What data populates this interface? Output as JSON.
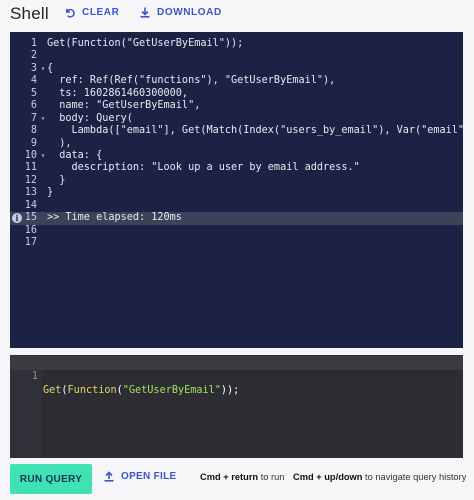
{
  "header": {
    "title": "Shell",
    "clear_label": "CLEAR",
    "download_label": "DOWNLOAD"
  },
  "output": {
    "highlight_line": 15,
    "lines": [
      {
        "num": "1",
        "fold": "",
        "text": "Get(Function(\"GetUserByEmail\"));"
      },
      {
        "num": "2",
        "fold": "",
        "text": ""
      },
      {
        "num": "3",
        "fold": "▾",
        "text": "{"
      },
      {
        "num": "4",
        "fold": "",
        "text": "  ref: Ref(Ref(\"functions\"), \"GetUserByEmail\"),"
      },
      {
        "num": "5",
        "fold": "",
        "text": "  ts: 1602861460300000,"
      },
      {
        "num": "6",
        "fold": "",
        "text": "  name: \"GetUserByEmail\","
      },
      {
        "num": "7",
        "fold": "▾",
        "text": "  body: Query("
      },
      {
        "num": "8",
        "fold": "",
        "text": "    Lambda([\"email\"], Get(Match(Index(\"users_by_email\"), Var(\"email\"))))"
      },
      {
        "num": "9",
        "fold": "",
        "text": "  ),"
      },
      {
        "num": "10",
        "fold": "▾",
        "text": "  data: {"
      },
      {
        "num": "11",
        "fold": "",
        "text": "    description: \"Look up a user by email address.\""
      },
      {
        "num": "12",
        "fold": "",
        "text": "  }"
      },
      {
        "num": "13",
        "fold": "",
        "text": "}"
      },
      {
        "num": "14",
        "fold": "",
        "text": ""
      },
      {
        "num": "15",
        "fold": "",
        "text": ">> Time elapsed: 120ms"
      },
      {
        "num": "16",
        "fold": "",
        "text": ""
      },
      {
        "num": "17",
        "fold": "",
        "text": ""
      }
    ]
  },
  "editor": {
    "line_number": "1",
    "tokens": {
      "fn1": "Get",
      "p1": "(",
      "fn2": "Function",
      "p2": "(",
      "str": "\"GetUserByEmail\"",
      "p3": "));"
    }
  },
  "footer": {
    "run_label": "RUN QUERY",
    "open_label": "OPEN FILE",
    "hint_run_key": "Cmd + return",
    "hint_run_text": " to run",
    "hint_nav_key": "Cmd + up/down",
    "hint_nav_text": " to navigate query history"
  },
  "colors": {
    "accent": "#3c55c9",
    "run_button": "#3fe2b3",
    "output_bg": "#1b2244",
    "editor_bg": "#2c2d33"
  },
  "icons": {
    "clear": "undo-icon",
    "download": "download-icon",
    "open": "upload-icon",
    "info": "info-icon"
  }
}
